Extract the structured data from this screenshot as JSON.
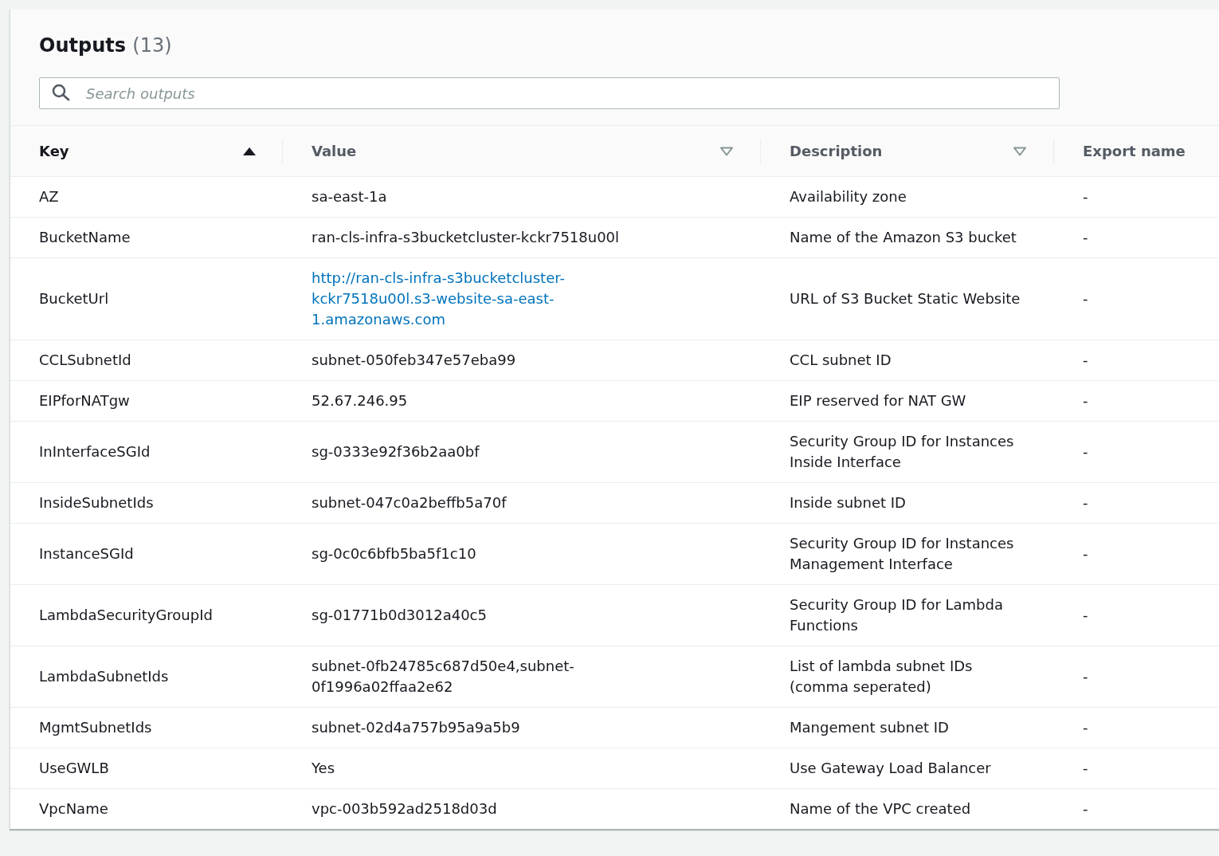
{
  "panel": {
    "title": "Outputs",
    "count": "(13)"
  },
  "search": {
    "placeholder": "Search outputs"
  },
  "table": {
    "columns": [
      {
        "label": "Key",
        "sorted": true
      },
      {
        "label": "Value",
        "sorted": false
      },
      {
        "label": "Description",
        "sorted": false
      },
      {
        "label": "Export name"
      }
    ],
    "rows": [
      {
        "key": "AZ",
        "value": "sa-east-1a",
        "link": false,
        "description": "Availability zone",
        "export": "-"
      },
      {
        "key": "BucketName",
        "value": "ran-cls-infra-s3bucketcluster-kckr7518u00l",
        "link": false,
        "description": "Name of the Amazon S3 bucket",
        "export": "-"
      },
      {
        "key": "BucketUrl",
        "value": "http://ran-cls-infra-s3bucketcluster-kckr7518u00l.s3-website-sa-east-1.amazonaws.com",
        "link": true,
        "description": "URL of S3 Bucket Static Website",
        "export": "-"
      },
      {
        "key": "CCLSubnetId",
        "value": "subnet-050feb347e57eba99",
        "link": false,
        "description": "CCL subnet ID",
        "export": "-"
      },
      {
        "key": "EIPforNATgw",
        "value": "52.67.246.95",
        "link": false,
        "description": "EIP reserved for NAT GW",
        "export": "-"
      },
      {
        "key": "InInterfaceSGId",
        "value": "sg-0333e92f36b2aa0bf",
        "link": false,
        "description": "Security Group ID for Instances Inside Interface",
        "export": "-"
      },
      {
        "key": "InsideSubnetIds",
        "value": "subnet-047c0a2beffb5a70f",
        "link": false,
        "description": "Inside subnet ID",
        "export": "-"
      },
      {
        "key": "InstanceSGId",
        "value": "sg-0c0c6bfb5ba5f1c10",
        "link": false,
        "description": "Security Group ID for Instances Management Interface",
        "export": "-"
      },
      {
        "key": "LambdaSecurityGroupId",
        "value": "sg-01771b0d3012a40c5",
        "link": false,
        "description": "Security Group ID for Lambda Functions",
        "export": "-"
      },
      {
        "key": "LambdaSubnetIds",
        "value": "subnet-0fb24785c687d50e4,subnet-0f1996a02ffaa2e62",
        "link": false,
        "description": "List of lambda subnet IDs (comma seperated)",
        "export": "-"
      },
      {
        "key": "MgmtSubnetIds",
        "value": "subnet-02d4a757b95a9a5b9",
        "link": false,
        "description": "Mangement subnet ID",
        "export": "-"
      },
      {
        "key": "UseGWLB",
        "value": "Yes",
        "link": false,
        "description": "Use Gateway Load Balancer",
        "export": "-"
      },
      {
        "key": "VpcName",
        "value": "vpc-003b592ad2518d03d",
        "link": false,
        "description": "Name of the VPC created",
        "export": "-"
      }
    ]
  }
}
